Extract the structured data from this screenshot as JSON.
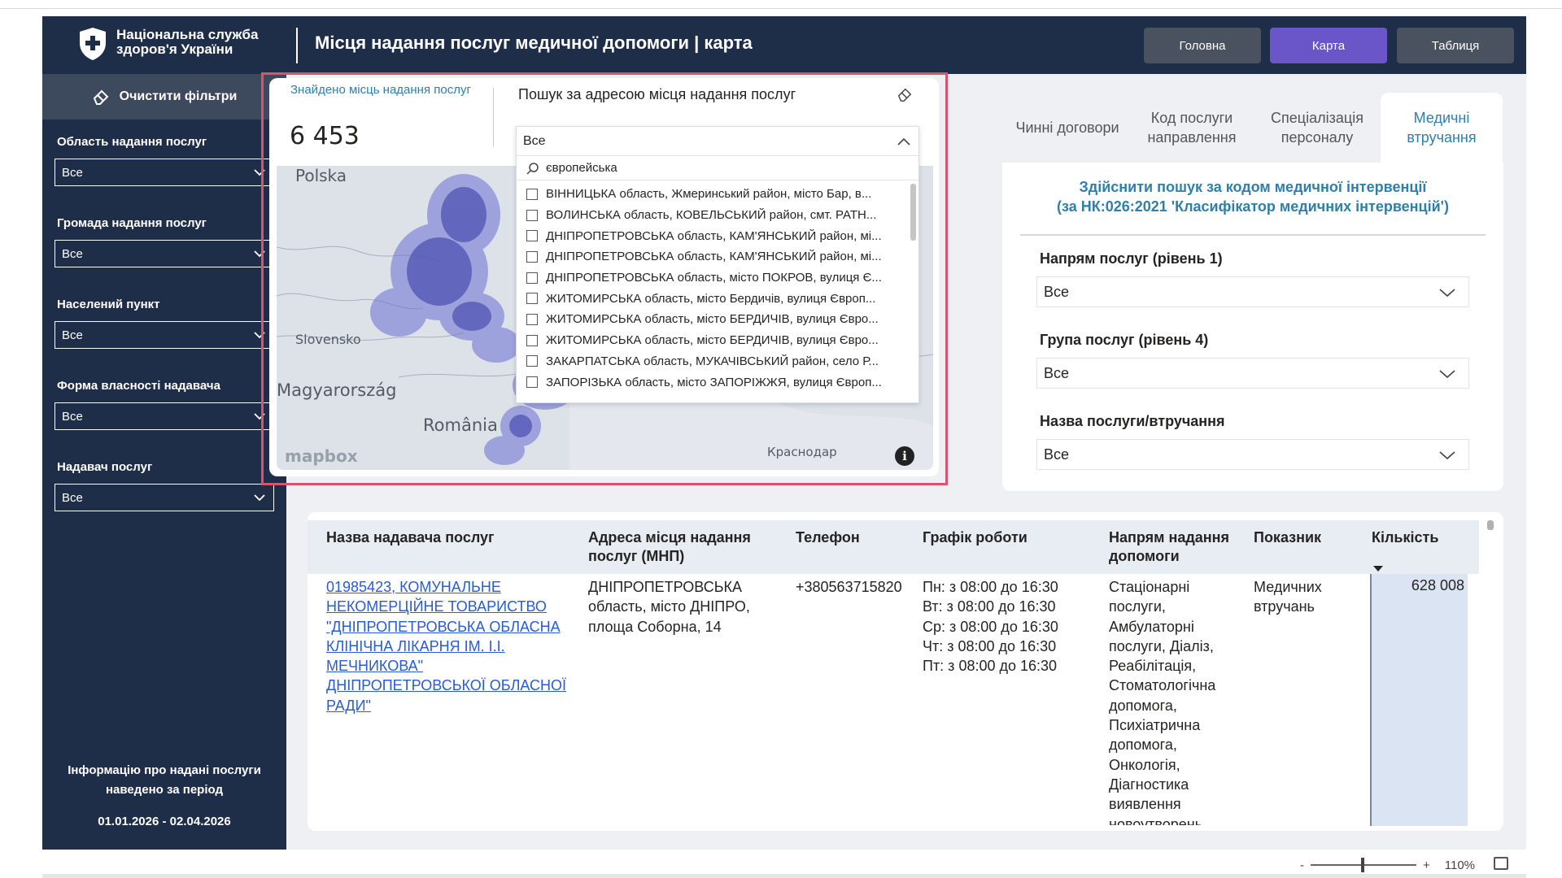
{
  "header": {
    "org_line1": "Національна служба",
    "org_line2": "здоров'я України",
    "title": "Місця надання послуг медичної допомоги | карта",
    "nav": [
      {
        "label": "Головна"
      },
      {
        "label": "Карта"
      },
      {
        "label": "Таблиця"
      }
    ],
    "accent_color": "#6a56c9",
    "bg_color": "#1e2d48"
  },
  "sidebar": {
    "clear_filters": "Очистити фільтри",
    "filters": [
      {
        "label": "Область надання послуг",
        "value": "Все"
      },
      {
        "label": "Громада надання послуг",
        "value": "Все"
      },
      {
        "label": "Населений пункт",
        "value": "Все"
      },
      {
        "label": "Форма власності надавача",
        "value": "Все"
      },
      {
        "label": "Надавач послуг",
        "value": "Все"
      }
    ],
    "period_note": "Інформацію про надані послуги наведено за період",
    "period_dates": "01.01.2026 - 02.04.2026"
  },
  "map_card": {
    "found_label": "Знайдено місць надання послуг",
    "found_value": "6 453",
    "search_title": "Пошук за адресою місця надання послуг",
    "selected_value": "Все",
    "search_query": "європейська",
    "options": [
      "ВІННИЦЬКА область, Жмеринський район, місто Бар, в...",
      "ВОЛИНСЬКА область, КОВЕЛЬСЬКИЙ район, смт. РАТН...",
      "ДНІПРОПЕТРОВСЬКА область, КАМ'ЯНСЬКИЙ район, мі...",
      "ДНІПРОПЕТРОВСЬКА область, КАМ'ЯНСЬКИЙ район, мі...",
      "ДНІПРОПЕТРОВСЬКА область, місто ПОКРОВ, вулиця Є...",
      "ЖИТОМИРСЬКА область, місто Бердичів, вулиця Європ...",
      "ЖИТОМИРСЬКА область, місто БЕРДИЧІВ, вулиця Євро...",
      "ЖИТОМИРСЬКА область, місто БЕРДИЧІВ, вулиця Євро...",
      "ЗАКАРПАТСЬКА область, МУКАЧІВСЬКИЙ район, село Р...",
      "ЗАПОРІЗЬКА область, місто ЗАПОРІЖЖЯ, вулиця Європ..."
    ],
    "map_labels": {
      "polska": "Polska",
      "slovensko": "Slovensko",
      "magyarorszag": "Magyarország",
      "romania": "România",
      "krasnodar": "Краснодар"
    },
    "mapbox": "mapbox",
    "info": "i",
    "border_color": "#d9546a"
  },
  "right_panel": {
    "tabs": [
      {
        "label": "Чинні договори"
      },
      {
        "label": "Код послуги направлення"
      },
      {
        "label": "Спеціалізація персоналу"
      },
      {
        "label": "Медичні втручання"
      }
    ],
    "title_line1": "Здійснити пошук за кодом медичної інтервенції",
    "title_line2": "(за НК:026:2021 'Класифікатор медичних інтервенцій')",
    "fields": [
      {
        "label": "Напрям послуг (рівень 1)",
        "value": "Все"
      },
      {
        "label": "Група послуг (рівень 4)",
        "value": "Все"
      },
      {
        "label": "Назва послуги/втручання",
        "value": "Все"
      }
    ]
  },
  "table": {
    "columns": [
      "Назва надавача послуг",
      "Адреса місця надання послуг (МНП)",
      "Телефон",
      "Графік роботи",
      "Напрям надання допомоги",
      "Показник",
      "Кількість"
    ],
    "row": {
      "provider": "01985423, КОМУНАЛЬНЕ НЕКОМЕРЦІЙНЕ ТОВАРИСТВО \"ДНІПРОПЕТРОВСЬКА ОБЛАСНА КЛІНІЧНА ЛІКАРНЯ ІМ. І.І. МЕЧНИКОВА\" ДНІПРОПЕТРОВСЬКОЇ ОБЛАСНОЇ РАДИ\"",
      "address": "ДНІПРОПЕТРОВСЬКА область, місто ДНІПРО, площа Соборна, 14",
      "phone": "+380563715820",
      "schedule": [
        "Пн: з 08:00 до 16:30",
        "Вт: з 08:00 до 16:30",
        "Ср: з 08:00 до 16:30",
        "Чт: з 08:00 до 16:30",
        "Пт: з 08:00 до 16:30"
      ],
      "direction": "Стаціонарні послуги, Амбулаторні послуги, Діаліз, Реабілітація, Стоматологічна допомога, Психіатрична допомога, Онкологія, Діагностика виявлення новоутворень",
      "indicator": "Медичних втручань",
      "quantity": "628 008"
    }
  },
  "footer": {
    "zoom_minus": "-",
    "zoom_plus": "+",
    "zoom_level": "110%"
  }
}
